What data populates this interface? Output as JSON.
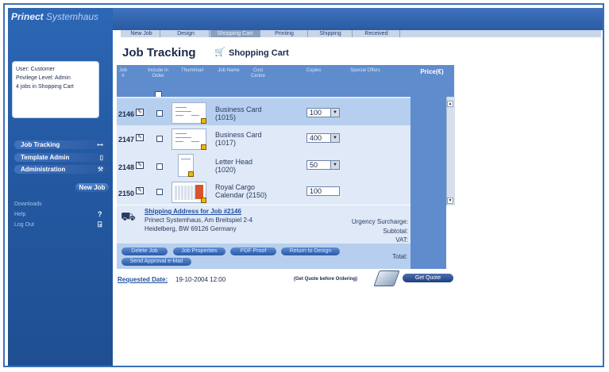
{
  "app": {
    "brand_main": "Prinect",
    "brand_sub": "Systemhaus"
  },
  "sidebar": {
    "small_label": "",
    "user_info": [
      "User: Customer",
      "Privilege Level: Admin",
      "4 jobs in  Shopping Cart"
    ],
    "nav": [
      {
        "label": "Job Tracking",
        "icon": "cart-icon"
      },
      {
        "label": "Template Admin",
        "icon": "document-icon"
      },
      {
        "label": "Administration",
        "icon": "wrench-icon"
      }
    ],
    "new_job": "New Job",
    "links": [
      {
        "label": "Downloads",
        "icon": ""
      },
      {
        "label": "Help",
        "icon": "?"
      },
      {
        "label": "Log Out",
        "icon": "B"
      }
    ]
  },
  "tabs": [
    {
      "label": "New Job",
      "active": false
    },
    {
      "label": "Design",
      "active": false
    },
    {
      "label": "Shopping Cart",
      "active": true
    },
    {
      "label": "Printing",
      "active": false
    },
    {
      "label": "Shipping",
      "active": false
    },
    {
      "label": "Received",
      "active": false
    }
  ],
  "header": {
    "title": "Job Tracking",
    "subtitle": "Shopping Cart"
  },
  "table": {
    "columns": [
      "Job #",
      "Include in Order",
      "Thumbnail",
      "Job Name",
      "Cost Centre",
      "Copies",
      "Special Offers",
      "Price(€)"
    ],
    "rows": [
      {
        "job": "2146",
        "name1": "Business Card",
        "name2": "(1015)",
        "copies": "100",
        "has_dropdown": true,
        "thumb": "card"
      },
      {
        "job": "2147",
        "name1": "Business Card",
        "name2": "(1017)",
        "copies": "400",
        "has_dropdown": true,
        "thumb": "card"
      },
      {
        "job": "2148",
        "name1": "Letter Head",
        "name2": "(1020)",
        "copies": "50",
        "has_dropdown": true,
        "thumb": "letter"
      },
      {
        "job": "2150",
        "name1": "Royal Cargo",
        "name2": "Calendar (2150)",
        "copies": "100",
        "has_dropdown": false,
        "thumb": "calendar"
      }
    ]
  },
  "shipping": {
    "link": "Shipping Address for Job #2146",
    "line1": "Prinect  Systemhaus, Am Breitspiel 2-4",
    "line2": "Heidelberg, BW 69126 Germany"
  },
  "summary": {
    "urgency": "Urgency Surcharge:",
    "subtotal": "Subtotal:",
    "vat": "VAT:",
    "total": "Total:"
  },
  "actions": {
    "delete_job": "Delete Job",
    "job_properties": "Job Properties",
    "pdf_proof": "PDF Proof",
    "return_to_design": "Return to Design",
    "send_approval": "Send Approval e-Mail"
  },
  "footer": {
    "requested_label": "Requested Date:",
    "requested_value": "19-10-2004 12:00",
    "quote_note": "(Get Quote before Ordering)",
    "get_quote": "Get Quote"
  }
}
